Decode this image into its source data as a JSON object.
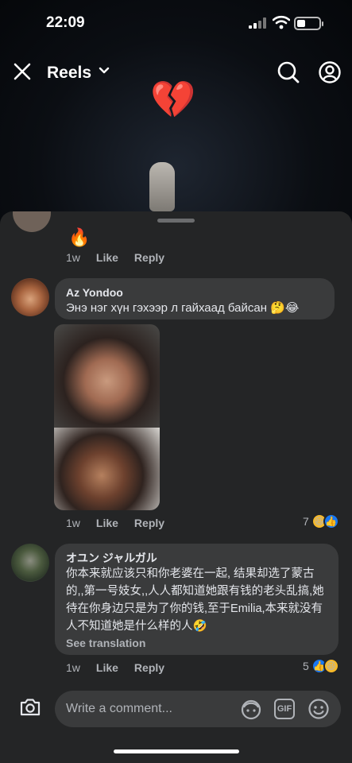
{
  "status_bar": {
    "time": "22:09"
  },
  "header": {
    "title": "Reels"
  },
  "video": {
    "emoji": "💔"
  },
  "comments": [
    {
      "author": "",
      "text": "🔥",
      "time": "1w",
      "like_label": "Like",
      "reply_label": "Reply"
    },
    {
      "author": "Az Yondoo",
      "text": "Энэ нэг хүн гэхээр л гайхаад байсан 🤔😂",
      "time": "1w",
      "like_label": "Like",
      "reply_label": "Reply",
      "reaction_count": "7",
      "reactions": [
        "haha",
        "like"
      ]
    },
    {
      "author": "オユン ジャルガル",
      "text": "你本来就应该只和你老婆在一起, 结果却选了蒙古的,,第一号妓女,,人人都知道她跟有钱的老头乱搞,她待在你身边只是为了你的钱,至于Emilia,本来就没有人不知道她是什么样的人🤣",
      "see_translation": "See translation",
      "time": "1w",
      "like_label": "Like",
      "reply_label": "Reply",
      "reaction_count": "5",
      "reactions": [
        "like",
        "haha"
      ]
    }
  ],
  "composer": {
    "placeholder": "Write a comment...",
    "gif_label": "GIF"
  },
  "colors": {
    "sheet": "#242526",
    "bubble": "#3a3b3c",
    "secondary_text": "#b0b3b8",
    "like_blue": "#1877f2"
  }
}
